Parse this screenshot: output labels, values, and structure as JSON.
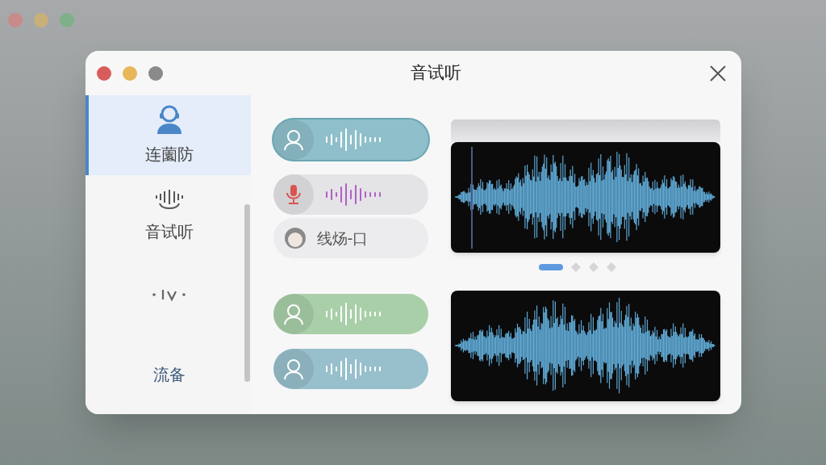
{
  "window": {
    "title": "音试听"
  },
  "sidebar": {
    "items": [
      {
        "kind": "person",
        "label": "连薗防",
        "selected": true
      },
      {
        "kind": "headset",
        "label": "音试听",
        "selected": false
      },
      {
        "kind": "wave",
        "selected": false
      },
      {
        "kind": "text",
        "label": "流备",
        "selected": false
      }
    ]
  },
  "voices": [
    {
      "kind": "person",
      "color": "#8fbfca",
      "selected": true
    },
    {
      "kind": "mic",
      "color": "#e4e4e6",
      "selected": false
    },
    {
      "kind": "name",
      "label": "线炀-口",
      "color": "#ececee",
      "selected": false
    },
    {
      "kind": "person",
      "color": "#a9cfa8",
      "selected": false
    },
    {
      "kind": "person",
      "color": "#97bfcc",
      "selected": false
    }
  ],
  "pager": [
    {
      "selected": true
    },
    {
      "selected": false
    },
    {
      "selected": false
    },
    {
      "selected": false
    }
  ]
}
